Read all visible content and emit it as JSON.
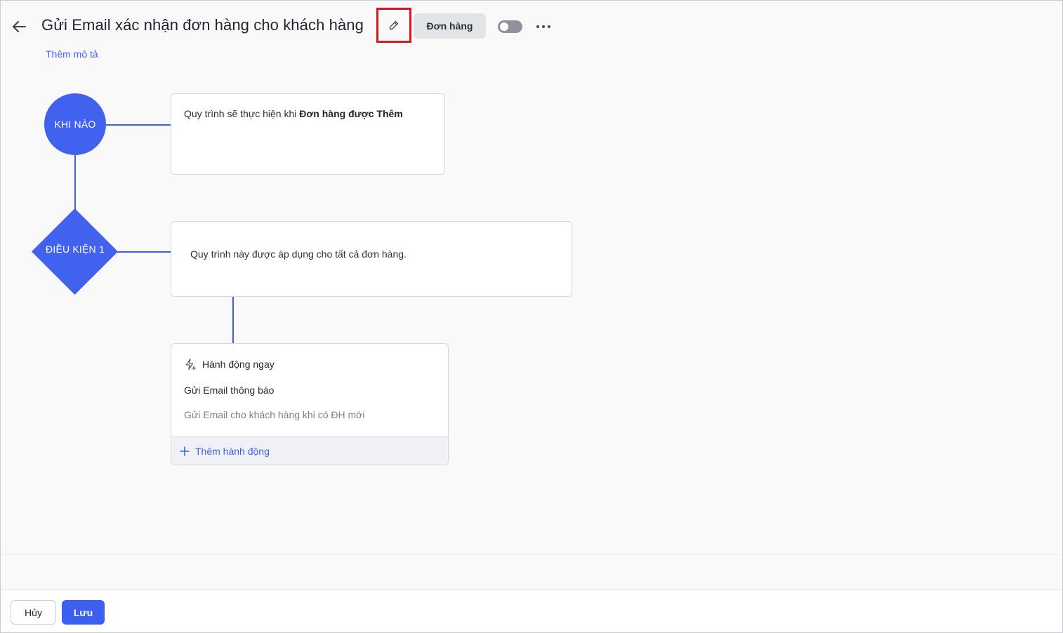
{
  "header": {
    "title": "Gửi Email xác nhận đơn hàng cho khách hàng",
    "tag_label": "Đơn hàng",
    "add_description": "Thêm mô tả",
    "toggle_state": "off"
  },
  "flow": {
    "trigger_node_label": "KHI NÀO",
    "trigger_text_prefix": "Quy trình sẽ thực hiện khi ",
    "trigger_text_bold": "Đơn hàng được Thêm",
    "condition_node_label": "ĐIỀU KIỆN 1",
    "condition_text": "Quy trình này được áp dụng cho tất cả đơn hàng.",
    "action": {
      "heading": "Hành động ngay",
      "name": "Gửi Email thông báo",
      "description": "Gửi Email cho khách hàng khi có ĐH mới",
      "add_label": "Thêm hành động"
    }
  },
  "footer": {
    "cancel_label": "Hủy",
    "save_label": "Lưu"
  },
  "colors": {
    "accent": "#4162ee",
    "link": "#3d64e6",
    "highlight_border": "#e0141e"
  },
  "icons": [
    "arrow-left-icon",
    "pencil-icon",
    "more-horizontal-icon",
    "lightning-icon",
    "plus-icon"
  ]
}
